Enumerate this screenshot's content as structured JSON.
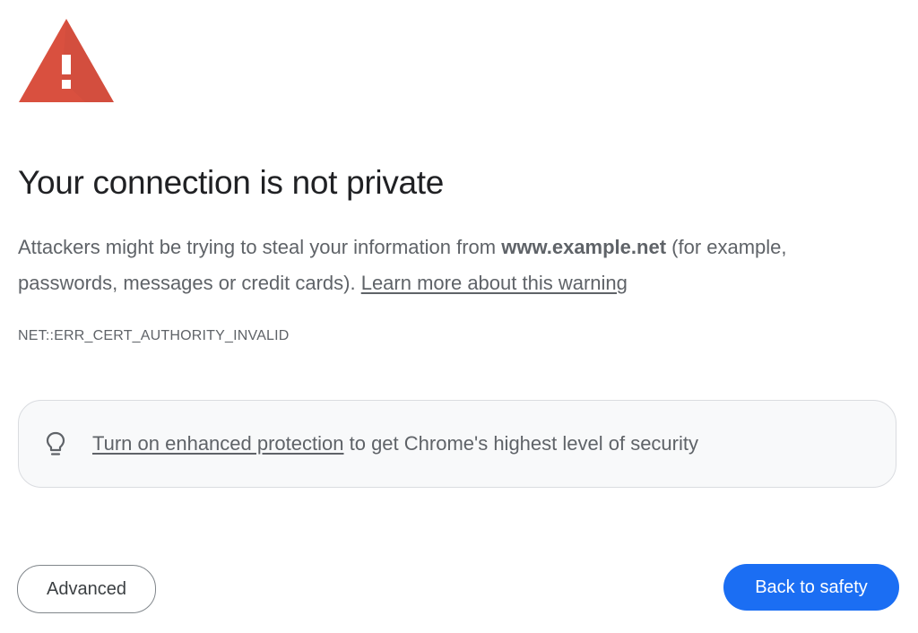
{
  "colors": {
    "warning_red": "#d9503f",
    "primary_blue": "#1b6ef3",
    "text_gray": "#5f6368",
    "title_dark": "#202124"
  },
  "icons": {
    "warning": "warning-triangle-icon",
    "tip": "lightbulb-icon"
  },
  "main": {
    "title": "Your connection is not private",
    "description": {
      "prefix": "Attackers might be trying to steal your information from ",
      "domain": "www.example.net",
      "suffix": " (for example, passwords, messages or credit cards). ",
      "learn_more_link": "Learn more about this warning"
    },
    "error_code": "NET::ERR_CERT_AUTHORITY_INVALID"
  },
  "promo": {
    "link_text": "Turn on enhanced protection",
    "text": " to get Chrome's highest level of security"
  },
  "buttons": {
    "advanced_label": "Advanced",
    "back_label": "Back to safety"
  }
}
